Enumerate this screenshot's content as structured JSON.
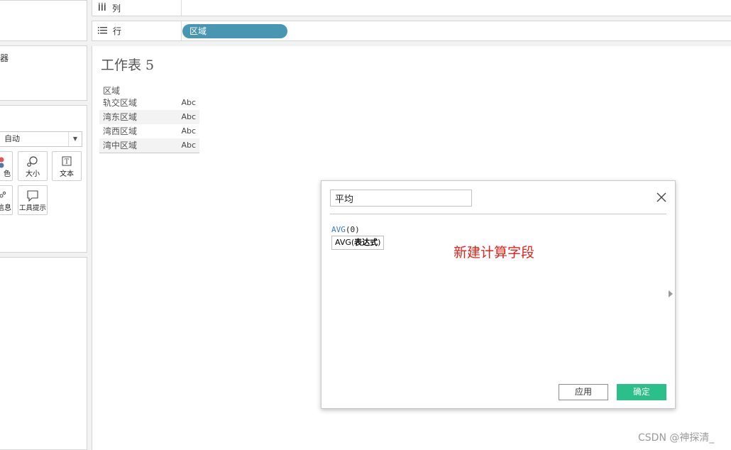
{
  "left_panel": {
    "filters_label": "器",
    "marks": {
      "type_value": "自动",
      "buttons": [
        {
          "label": "色",
          "icon": "color-icon"
        },
        {
          "label": "大小",
          "icon": "size-icon"
        },
        {
          "label": "文本",
          "icon": "text-icon"
        },
        {
          "label": "信息",
          "icon": "detail-icon"
        },
        {
          "label": "工具提示",
          "icon": "tooltip-icon"
        }
      ]
    }
  },
  "shelves": {
    "columns_label": "列",
    "rows_label": "行",
    "rows_pill": "区域"
  },
  "worksheet": {
    "title": "工作表 5",
    "table": {
      "header": "区域",
      "rows": [
        {
          "name": "轨交区域",
          "value": "Abc"
        },
        {
          "name": "湾东区域",
          "value": "Abc"
        },
        {
          "name": "湾西区域",
          "value": "Abc"
        },
        {
          "name": "湾中区域",
          "value": "Abc"
        }
      ]
    }
  },
  "dialog": {
    "name_value": "平均",
    "formula_function": "AVG",
    "formula_args": "(0)",
    "autocomplete_prefix": "AVG(",
    "autocomplete_param": "表达式",
    "autocomplete_suffix": ")",
    "annotation": "新建计算字段",
    "apply_label": "应用",
    "ok_label": "确定"
  },
  "watermark": "CSDN @神探清_",
  "colors": {
    "pill": "#4996b2",
    "ok_button": "#2bbf8a",
    "annotation": "#e2231a",
    "function_token": "#3d7cc4"
  }
}
